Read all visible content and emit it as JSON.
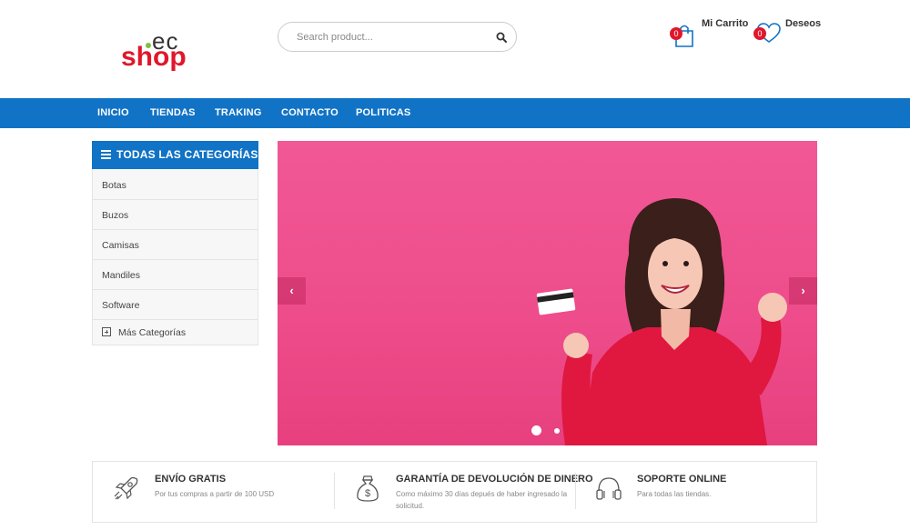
{
  "header": {
    "logo": {
      "top": "ec",
      "bottom": "shop"
    },
    "search": {
      "placeholder": "Search product..."
    },
    "cart": {
      "label": "Mi Carrito",
      "count": "0"
    },
    "wishlist": {
      "label": "Deseos",
      "count": "0"
    }
  },
  "nav": {
    "items": [
      "INICIO",
      "TIENDAS",
      "TRAKING",
      "CONTACTO",
      "POLITICAS"
    ]
  },
  "categories": {
    "title": "TODAS LAS CATEGORÍAS",
    "items": [
      "Botas",
      "Buzos",
      "Camisas",
      "Mandiles",
      "Software"
    ],
    "more": "Más Categorías"
  },
  "slider": {
    "prev": "‹",
    "next": "›",
    "active_slide": 1,
    "slide_count": 2
  },
  "features": [
    {
      "title": "ENVÍO GRATIS",
      "text": "Por tus compras a partir de 100 USD",
      "icon": "rocket-icon"
    },
    {
      "title": "GARANTÍA DE DEVOLUCIÓN DE DINERO",
      "text": "Como máximo 30 días depués de haber ingresado la solicitud.",
      "icon": "money-bag-icon"
    },
    {
      "title": "SOPORTE ONLINE",
      "text": "Para todas las tiendas.",
      "icon": "headphones-icon"
    }
  ],
  "colors": {
    "primary": "#1173c5",
    "accent": "#e0172b",
    "slider_bg": "#ee4d8b"
  }
}
